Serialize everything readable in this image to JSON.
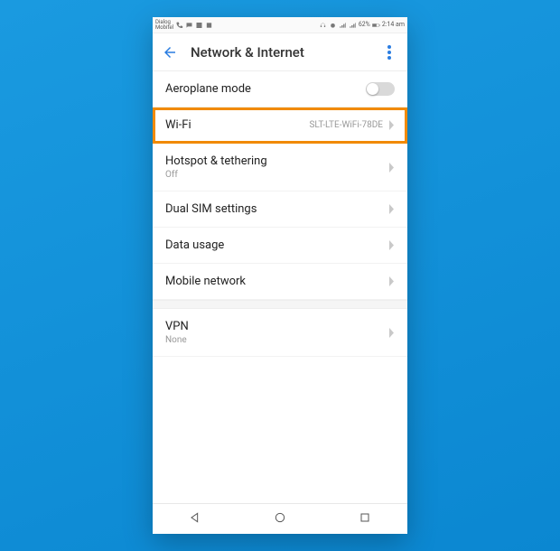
{
  "statusbar": {
    "carrier": "Dialog\nMobitel",
    "battery_pct": "62%",
    "time": "2:14 am"
  },
  "appbar": {
    "title": "Network & Internet"
  },
  "rows": {
    "aeroplane": {
      "label": "Aeroplane mode"
    },
    "wifi": {
      "label": "Wi-Fi",
      "value": "SLT-LTE-WiFi-78DE"
    },
    "hotspot": {
      "label": "Hotspot & tethering",
      "sub": "Off"
    },
    "dualsim": {
      "label": "Dual SIM settings"
    },
    "datausage": {
      "label": "Data usage"
    },
    "mobilenet": {
      "label": "Mobile network"
    },
    "vpn": {
      "label": "VPN",
      "sub": "None"
    }
  }
}
